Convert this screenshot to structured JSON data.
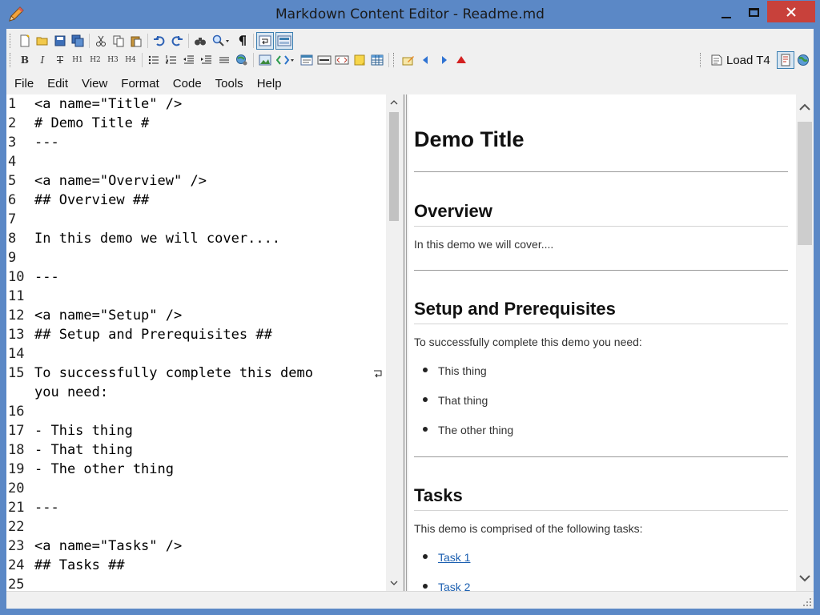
{
  "window": {
    "title": "Markdown Content Editor - Readme.md",
    "accent": "#5b88c6",
    "close_color": "#c8413b"
  },
  "toolbar1": {
    "icons": [
      "new-file-icon",
      "open-folder-icon",
      "save-icon",
      "save-all-icon",
      "cut-icon",
      "copy-icon",
      "paste-icon",
      "undo-icon",
      "redo-icon",
      "find-icon",
      "zoom-icon",
      "paragraph-icon",
      "word-wrap-icon",
      "html-view-icon"
    ]
  },
  "toolbar2": {
    "bold": "B",
    "italic": "I",
    "strike": "T",
    "h1": "H1",
    "h2": "H2",
    "h3": "H3",
    "h4": "H4",
    "load_label": "Load T4"
  },
  "menu": {
    "items": [
      "File",
      "Edit",
      "View",
      "Format",
      "Code",
      "Tools",
      "Help"
    ]
  },
  "editor": {
    "lines": [
      {
        "n": "1",
        "text": "<a name=\"Title\" />"
      },
      {
        "n": "2",
        "text": "# Demo Title #"
      },
      {
        "n": "3",
        "text": "---"
      },
      {
        "n": "4",
        "text": ""
      },
      {
        "n": "5",
        "text": "<a name=\"Overview\" />"
      },
      {
        "n": "6",
        "text": "## Overview ##"
      },
      {
        "n": "7",
        "text": ""
      },
      {
        "n": "8",
        "text": "In this demo we will cover...."
      },
      {
        "n": "9",
        "text": ""
      },
      {
        "n": "10",
        "text": "---"
      },
      {
        "n": "11",
        "text": ""
      },
      {
        "n": "12",
        "text": "<a name=\"Setup\" />"
      },
      {
        "n": "13",
        "text": "## Setup and Prerequisites ##"
      },
      {
        "n": "14",
        "text": ""
      },
      {
        "n": "15",
        "text": "To successfully complete this demo"
      },
      {
        "n": "",
        "text": "you need:"
      },
      {
        "n": "16",
        "text": ""
      },
      {
        "n": "17",
        "text": "- This thing"
      },
      {
        "n": "18",
        "text": "- That thing"
      },
      {
        "n": "19",
        "text": "- The other thing"
      },
      {
        "n": "20",
        "text": ""
      },
      {
        "n": "21",
        "text": "---"
      },
      {
        "n": "22",
        "text": ""
      },
      {
        "n": "23",
        "text": "<a name=\"Tasks\" />"
      },
      {
        "n": "24",
        "text": "## Tasks ##"
      },
      {
        "n": "25",
        "text": ""
      }
    ]
  },
  "preview": {
    "title": "Demo Title",
    "overview_heading": "Overview",
    "overview_text": "In this demo we will cover....",
    "setup_heading": "Setup and Prerequisites",
    "setup_text": "To successfully complete this demo you need:",
    "setup_items": [
      "This thing",
      "That thing",
      "The other thing"
    ],
    "tasks_heading": "Tasks",
    "tasks_text": "This demo is comprised of the following tasks:",
    "task_links": [
      "Task 1",
      "Task 2"
    ],
    "link_color": "#1b5fb0"
  }
}
